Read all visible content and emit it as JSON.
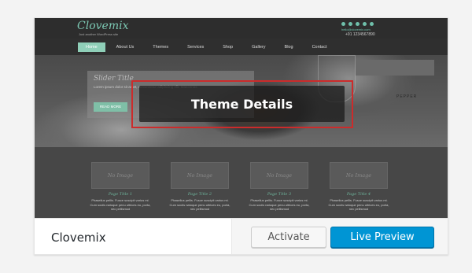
{
  "theme": {
    "name": "Clovemix",
    "details_label": "Theme Details",
    "activate_label": "Activate",
    "preview_label": "Live Preview"
  },
  "preview": {
    "logo": "Clovemix",
    "tagline": "Just another WordPress site",
    "email": "hello@clovemix.com",
    "phone": "+91 1234567890",
    "nav": [
      "Home",
      "About Us",
      "Themes",
      "Services",
      "Shop",
      "Gallery",
      "Blog",
      "Contact"
    ],
    "hero": {
      "title": "Slider Title",
      "text": "Lorem ipsum dolor sit amet, consectetur adipiscing elit. Maecenas",
      "button": "READ MORE",
      "sign": "PEPPER"
    },
    "tiles": [
      {
        "image": "No Image",
        "title": "Page Title 1",
        "text": "Phasellus pellis. Fusce suscipit varius mi. Cum sociis natoque penu ultrices eu, porta, nec pellismod"
      },
      {
        "image": "No Image",
        "title": "Page Title 2",
        "text": "Phasellus pellis. Fusce suscipit varius mi. Cum sociis natoque penu ultrices eu, porta, nec pellismod"
      },
      {
        "image": "No Image",
        "title": "Page Title 3",
        "text": "Phasellus pellis. Fusce suscipit varius mi. Cum sociis natoque penu ultrices eu, porta, nec pellismod"
      },
      {
        "image": "No Image",
        "title": "Page Title 4",
        "text": "Phasellus pellis. Fusce suscipit varius mi. Cum sociis natoque penu ultrices eu, porta, nec pellismod"
      }
    ]
  },
  "colors": {
    "accent": "#8fcfb8",
    "highlight_border": "#cc2b2b",
    "primary_button": "#0095d4"
  }
}
